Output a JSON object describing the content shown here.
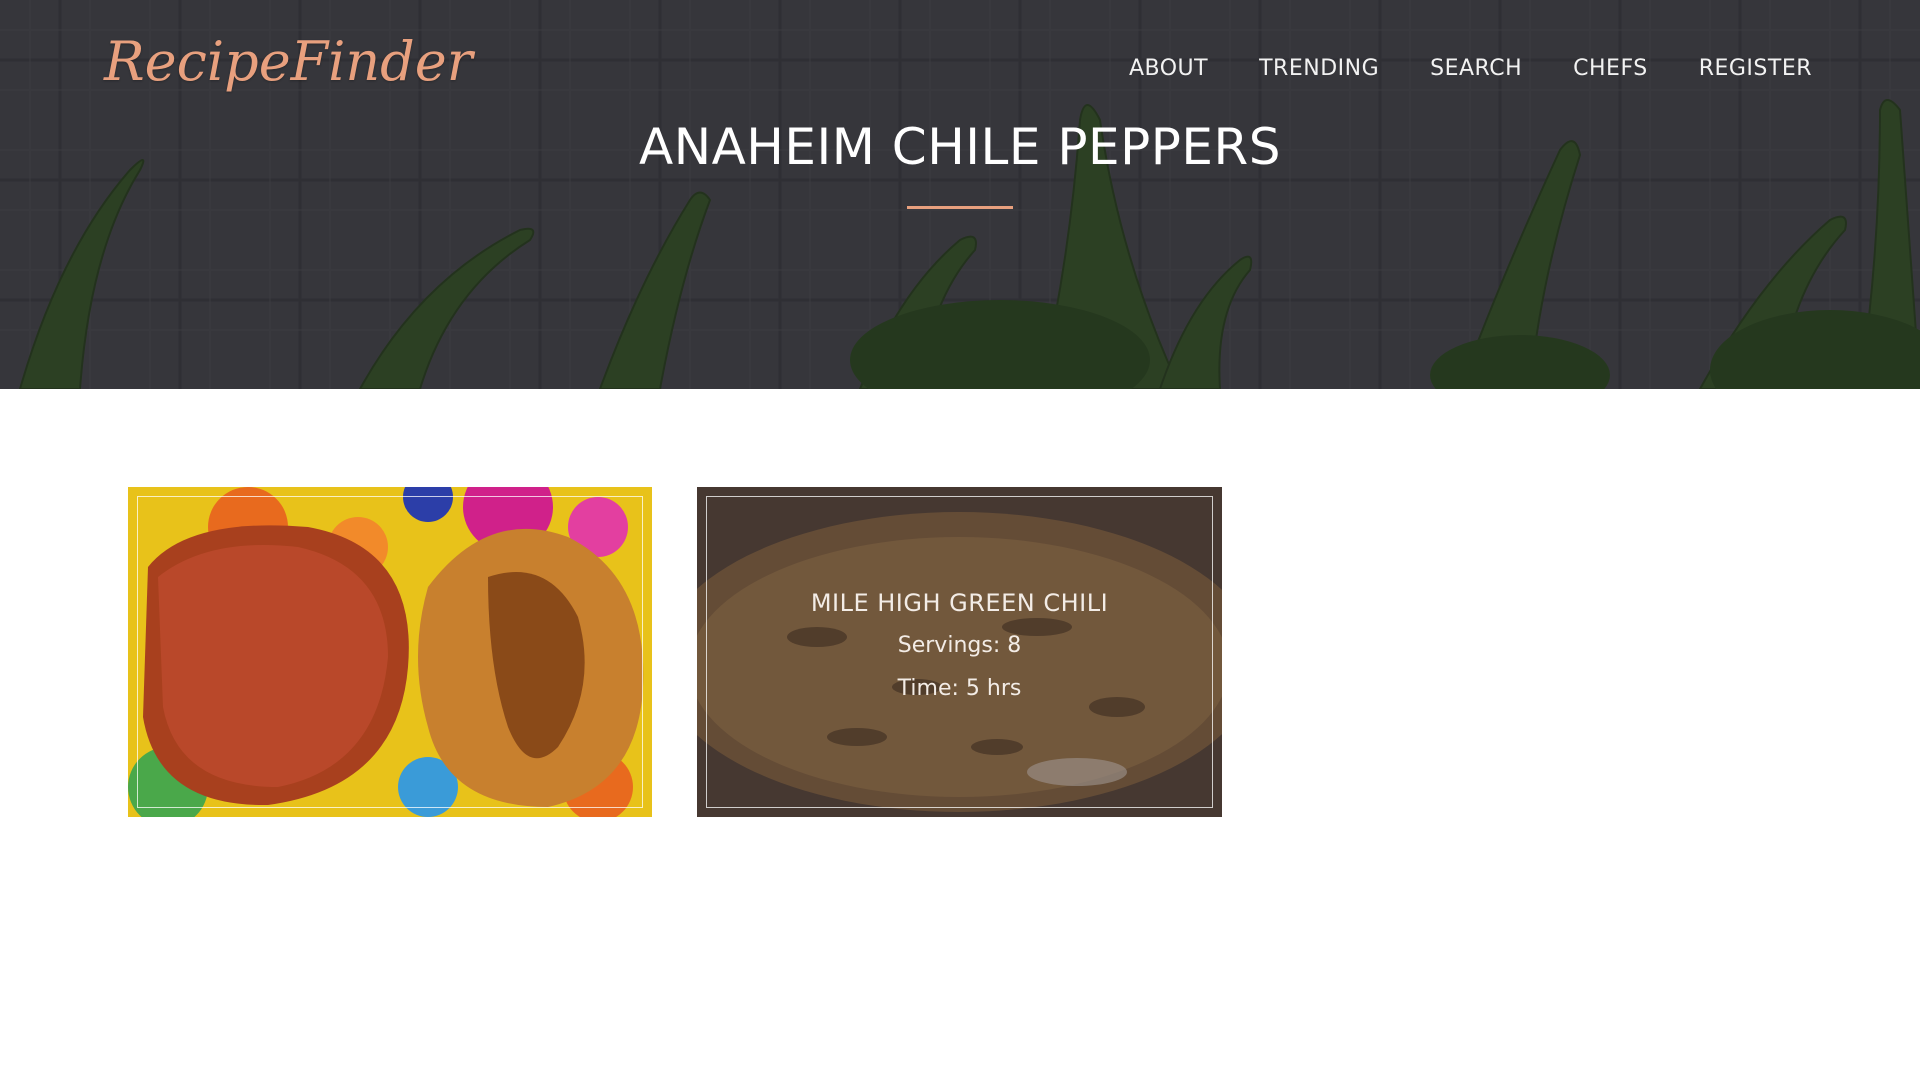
{
  "brand": {
    "name": "RecipeFinder",
    "color": "#e8a07e"
  },
  "nav": {
    "items": [
      {
        "label": "ABOUT"
      },
      {
        "label": "TRENDING"
      },
      {
        "label": "SEARCH"
      },
      {
        "label": "CHEFS"
      },
      {
        "label": "REGISTER"
      }
    ]
  },
  "hero": {
    "title": "ANAHEIM CHILE PEPPERS",
    "accent_color": "#e8a07e"
  },
  "recipes": [
    {
      "title": "",
      "servings": "",
      "time": ""
    },
    {
      "title": "MILE HIGH GREEN CHILI",
      "servings": "Servings: 8",
      "time": "Time: 5 hrs"
    }
  ]
}
